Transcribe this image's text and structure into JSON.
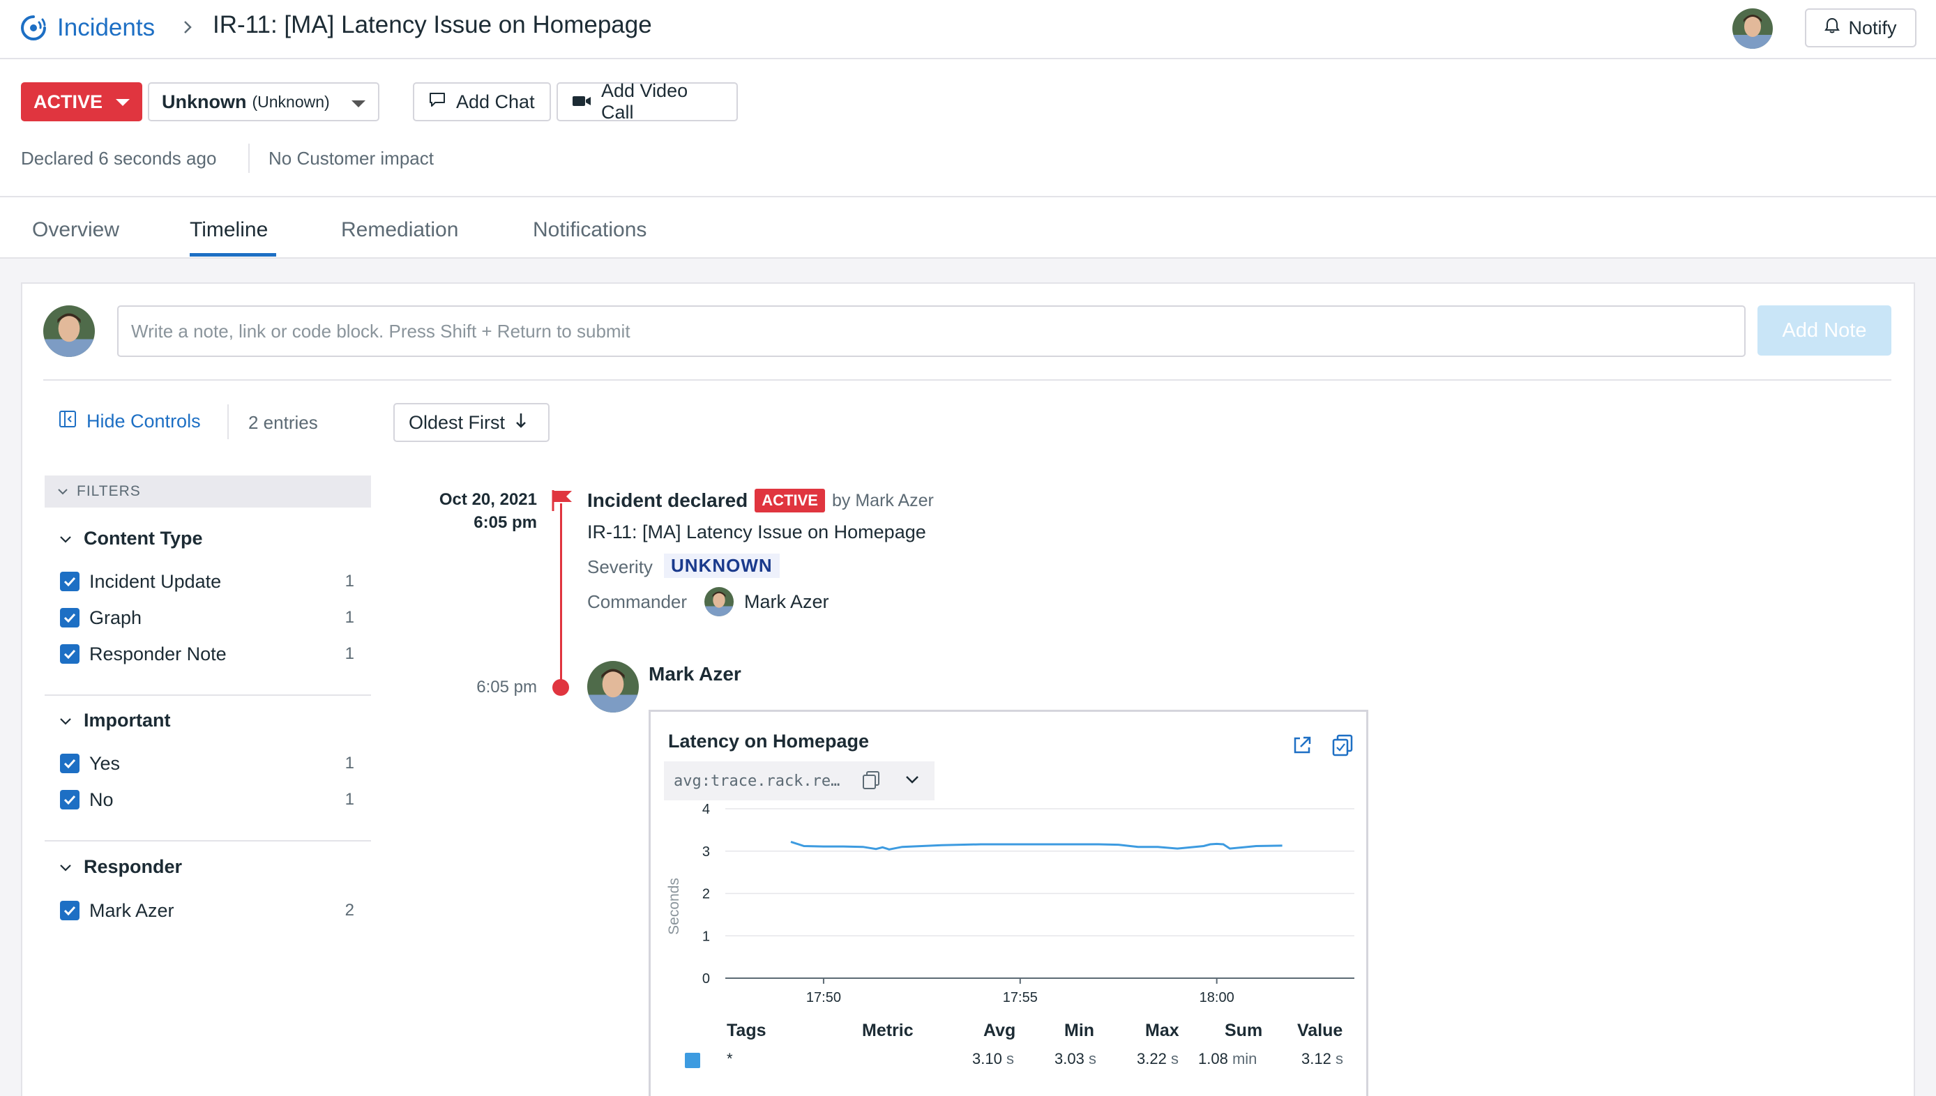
{
  "header": {
    "app_name": "Incidents",
    "incident_title": "IR-11: [MA] Latency Issue on Homepage",
    "notify_label": "Notify"
  },
  "status_bar": {
    "state": "ACTIVE",
    "severity": "Unknown",
    "severity_sub": "(Unknown)",
    "add_chat": "Add Chat",
    "add_video_call": "Add Video Call",
    "declared": "Declared 6 seconds ago",
    "customer_impact": "No Customer impact"
  },
  "tabs": [
    {
      "label": "Overview"
    },
    {
      "label": "Timeline"
    },
    {
      "label": "Remediation"
    },
    {
      "label": "Notifications"
    }
  ],
  "note": {
    "placeholder": "Write a note, link or code block. Press Shift + Return to submit",
    "button": "Add Note"
  },
  "controls": {
    "hide_controls": "Hide Controls",
    "entries": "2 entries",
    "sort": "Oldest First"
  },
  "filters": {
    "header": "FILTERS",
    "groups": [
      {
        "title": "Content Type",
        "items": [
          {
            "label": "Incident Update",
            "count": "1"
          },
          {
            "label": "Graph",
            "count": "1"
          },
          {
            "label": "Responder Note",
            "count": "1"
          }
        ]
      },
      {
        "title": "Important",
        "items": [
          {
            "label": "Yes",
            "count": "1"
          },
          {
            "label": "No",
            "count": "1"
          }
        ]
      },
      {
        "title": "Responder",
        "items": [
          {
            "label": "Mark Azer",
            "count": "2"
          }
        ]
      }
    ]
  },
  "timeline": {
    "event1": {
      "date": "Oct 20, 2021",
      "time": "6:05 pm",
      "title": "Incident declared",
      "badge": "ACTIVE",
      "by": "by Mark Azer",
      "incident": "IR-11: [MA] Latency Issue on Homepage",
      "severity_label": "Severity",
      "severity_value": "UNKNOWN",
      "commander_label": "Commander",
      "commander_name": "Mark Azer"
    },
    "event2": {
      "time": "6:05 pm",
      "author": "Mark Azer"
    }
  },
  "graph": {
    "title": "Latency on Homepage",
    "query": "avg:trace.rack.re…",
    "table": {
      "headers": [
        "Tags",
        "Metric",
        "Avg",
        "Min",
        "Max",
        "Sum",
        "Value"
      ],
      "row": {
        "tag": "*",
        "metric": "",
        "avg": "3.10",
        "avg_unit": "s",
        "min": "3.03",
        "min_unit": "s",
        "max": "3.22",
        "max_unit": "s",
        "sum": "1.08",
        "sum_unit": "min",
        "value": "3.12",
        "value_unit": "s"
      }
    }
  },
  "colors": {
    "accent": "#1d6fc4",
    "danger": "#e0353f",
    "series": "#3d9be0"
  },
  "chart_data": {
    "type": "line",
    "title": "Latency on Homepage",
    "xlabel": "",
    "ylabel": "Seconds",
    "ylim": [
      0,
      4
    ],
    "yticks": [
      "0",
      "1",
      "2",
      "3",
      "4"
    ],
    "xticks": [
      "17:50",
      "17:55",
      "18:00"
    ],
    "grid": true,
    "series": [
      {
        "color": "#3d9be0",
        "x": [
          "17:49:10",
          "17:49:30",
          "17:50:00",
          "17:50:30",
          "17:51:00",
          "17:51:20",
          "17:51:30",
          "17:51:40",
          "17:52:00",
          "17:53:00",
          "17:54:00",
          "17:55:00",
          "17:56:00",
          "17:57:00",
          "17:57:30",
          "17:58:00",
          "17:58:30",
          "17:59:00",
          "17:59:40",
          "17:59:50",
          "18:00:00",
          "18:00:10",
          "18:00:20",
          "18:01:00",
          "18:01:40"
        ],
        "y": [
          3.22,
          3.12,
          3.11,
          3.11,
          3.1,
          3.05,
          3.09,
          3.04,
          3.1,
          3.14,
          3.16,
          3.16,
          3.16,
          3.16,
          3.15,
          3.1,
          3.1,
          3.06,
          3.12,
          3.16,
          3.17,
          3.16,
          3.06,
          3.12,
          3.13
        ]
      }
    ]
  }
}
